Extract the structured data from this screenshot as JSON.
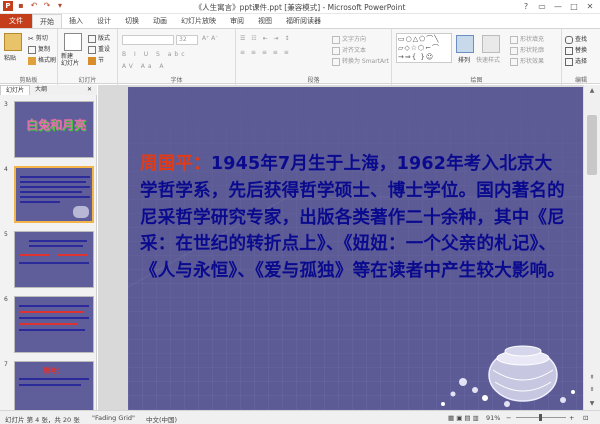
{
  "window": {
    "title": "《人生寓言》ppt课件.ppt [兼容模式] - Microsoft PowerPoint"
  },
  "tabs": [
    "文件",
    "开始",
    "插入",
    "设计",
    "切换",
    "动画",
    "幻灯片放映",
    "审阅",
    "视图",
    "福昕阅读器"
  ],
  "ribbon": {
    "clipboard": {
      "label": "剪贴板",
      "paste": "粘贴",
      "cut": "剪切",
      "copy": "复制",
      "format_painter": "格式刷"
    },
    "slides": {
      "label": "幻灯片",
      "new_slide": "新建\n幻灯片",
      "layout": "版式",
      "reset": "重设",
      "section": "节"
    },
    "font": {
      "label": "字体",
      "size": "32"
    },
    "paragraph": {
      "label": "段落",
      "text_direction": "文字方向",
      "align_text": "对齐文本",
      "smartart": "转换为 SmartArt"
    },
    "drawing": {
      "label": "绘图",
      "arrange": "排列",
      "quick_styles": "快速样式",
      "shape_fill": "形状填充",
      "shape_outline": "形状轮廓",
      "shape_effects": "形状效果"
    },
    "editing": {
      "label": "编辑",
      "find": "查找",
      "replace": "替换",
      "select": "选择"
    }
  },
  "panel": {
    "tab_slides": "幻灯片",
    "tab_outline": "大纲",
    "thumbs": [
      {
        "num": "3",
        "text": "白兔和月亮"
      },
      {
        "num": "4",
        "text": ""
      },
      {
        "num": "5",
        "text": ""
      },
      {
        "num": "6",
        "text": ""
      },
      {
        "num": "7",
        "text": "思考："
      }
    ]
  },
  "slide": {
    "name": "周国平：",
    "body": "1945年7月生于上海，1962年考入北京大学哲学系，先后获得哲学硕士、博士学位。国内著名的尼采哲学研究专家，出版各类著作二十余种，其中《尼采：在世纪的转折点上》、《妞妞：一个父亲的札记》、《人与永恒》、《爱与孤独》等在读者中产生较大影响。"
  },
  "status": {
    "slide_info": "幻灯片 第 4 张，共 20 张",
    "theme": "\"Fading Grid\"",
    "language": "中文(中国)",
    "zoom": "91%"
  },
  "colors": {
    "file_tab": "#c43e1c",
    "slide_bg": "#5c5b95",
    "slide_text": "#0a0a8f",
    "name_text": "#e23b17",
    "selected_thumb": "#f3b54a"
  }
}
